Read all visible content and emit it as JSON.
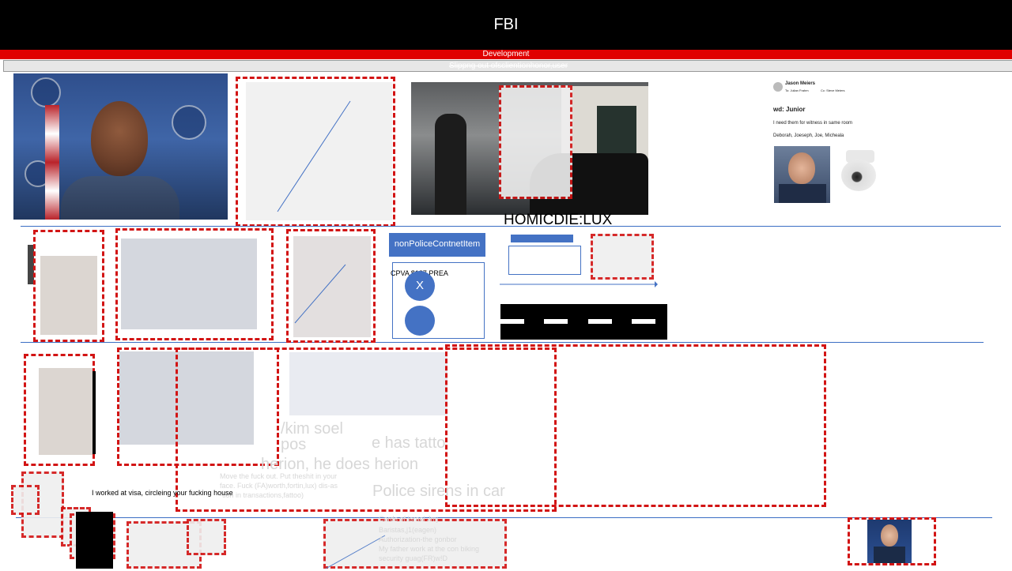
{
  "header": {
    "title": "FBI",
    "development_label": "Development",
    "sub_label": "Slippng out ofsclientionhonor,user"
  },
  "labels": {
    "homicide": "HOMICDIE:LUX",
    "non_police_button": "nonPoliceContnetItem",
    "cpva": "CPVA $187 PREA",
    "circle_x": "X",
    "worked_at_visa": "I worked at visa, circleing your fucking house"
  },
  "email": {
    "sender": "Jason Meiers",
    "to": "To: Julian Frahm",
    "cc": "Cc: Steve Meiers",
    "subject": "wd: Junior",
    "line1": "I need them for witness in same room",
    "line2": "Deborah, Joeseph, Joe, Micheala"
  },
  "faded_texts": {
    "kim": "/kim soel",
    "pos": "pos",
    "tattoo": "e has tatto",
    "herion": "herion, he does herion",
    "police": "Police sirens in car",
    "move": "Move the fuck out. Put theshit in your",
    "move2": "face. Fuck (FA)worth,fortin,lux) dis-as",
    "move3": "-tion in transactions,fattoo)",
    "cards": "Cards of Israel Jmj",
    "cards2": "Baristas,j1(eagen)",
    "cards3": "Authorization-the gonbor",
    "cards4": "My father work at the con biking",
    "cards5": "security guag(FR)w!D"
  },
  "colors": {
    "accent_blue": "#4472c4",
    "dash_red": "#d21414",
    "header_black": "#000000",
    "dev_red": "#e00000"
  }
}
